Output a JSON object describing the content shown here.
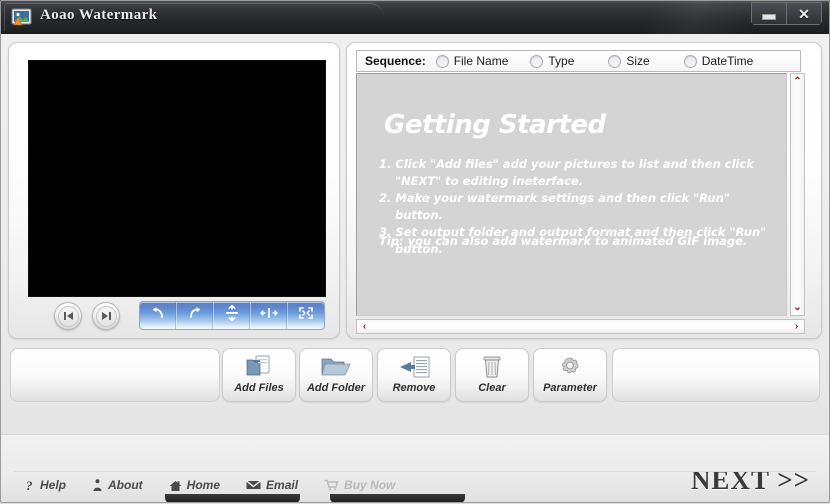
{
  "window": {
    "title": "Aoao Watermark",
    "app_icon": "picture-app-icon",
    "minimize_label": "–",
    "close_label": "✕"
  },
  "preview": {
    "nav_prev_icon": "skip-previous-icon",
    "nav_next_icon": "skip-next-icon",
    "transform_buttons": [
      {
        "icon": "rotate-left-icon",
        "glyph": "↶"
      },
      {
        "icon": "rotate-right-icon",
        "glyph": "↷"
      },
      {
        "icon": "flip-vertical-icon",
        "glyph": "⇵"
      },
      {
        "icon": "flip-horizontal-icon",
        "glyph": "⇹"
      },
      {
        "icon": "fullscreen-icon",
        "glyph": "⛶"
      }
    ]
  },
  "sequence": {
    "label": "Sequence:",
    "options": [
      {
        "label": "File Name",
        "selected": false
      },
      {
        "label": "Type",
        "selected": false
      },
      {
        "label": "Size",
        "selected": false
      },
      {
        "label": "DateTime",
        "selected": false
      }
    ]
  },
  "getting_started": {
    "title": "Getting Started",
    "steps": [
      "1. Click \"Add files\" add your pictures to list and then click \"NEXT\" to editing ineterface.",
      "2. Make your watermark settings and then click \"Run\" button.",
      "3. Set output folder and output format and then click \"Run\" button."
    ],
    "tip": "Tip: you can also add watermark to animated GIF image."
  },
  "scrollbars": {
    "vertical_up": "⌃",
    "vertical_down": "⌄",
    "horizontal_left": "‹",
    "horizontal_right": "›"
  },
  "toolbar": {
    "buttons": [
      {
        "label": "Add Files",
        "icon": "add-files-icon"
      },
      {
        "label": "Add Folder",
        "icon": "add-folder-icon"
      },
      {
        "label": "Remove",
        "icon": "remove-icon"
      },
      {
        "label": "Clear",
        "icon": "clear-trash-icon"
      },
      {
        "label": "Parameter",
        "icon": "gear-icon"
      }
    ]
  },
  "footer": {
    "next_label": "NEXT >>",
    "links": [
      {
        "label": "Help",
        "icon": "question-mark-icon",
        "disabled": false
      },
      {
        "label": "About",
        "icon": "info-icon",
        "disabled": false
      },
      {
        "label": "Home",
        "icon": "house-icon",
        "disabled": false
      },
      {
        "label": "Email",
        "icon": "envelope-icon",
        "disabled": false
      },
      {
        "label": "Buy Now",
        "icon": "cart-icon",
        "disabled": true
      }
    ]
  },
  "colors": {
    "titlebar_dark": "#2b2e31",
    "list_background": "#d4d4d4",
    "transform_bar_blue": "#5e86cd",
    "scroll_arrow_red": "#8f1a20",
    "preview_black": "#000000"
  }
}
